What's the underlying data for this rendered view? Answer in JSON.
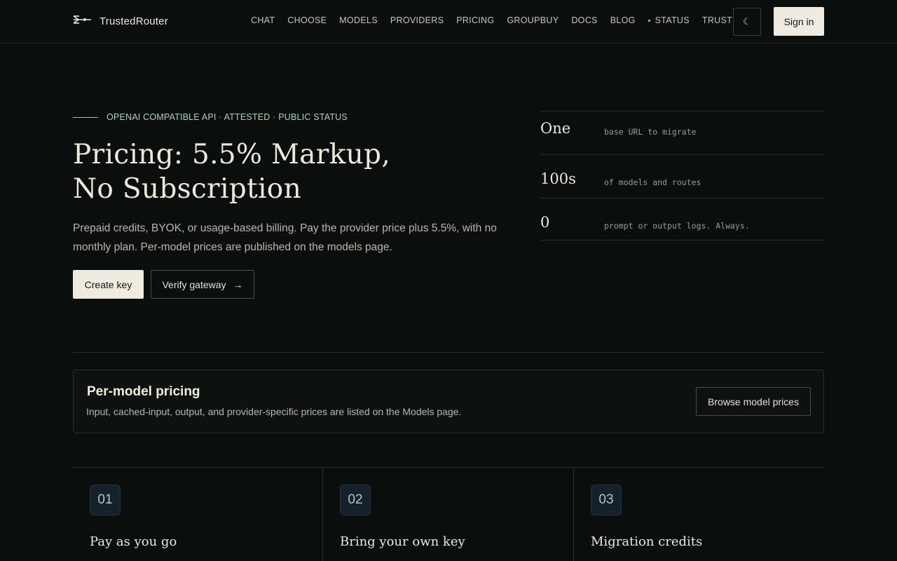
{
  "header": {
    "brand": "TrustedRouter",
    "nav": [
      {
        "label": "CHAT",
        "name": "nav-chat"
      },
      {
        "label": "CHOOSE",
        "name": "nav-choose"
      },
      {
        "label": "MODELS",
        "name": "nav-models"
      },
      {
        "label": "PROVIDERS",
        "name": "nav-providers"
      },
      {
        "label": "PRICING",
        "name": "nav-pricing"
      },
      {
        "label": "GROUPBUY",
        "name": "nav-groupbuy"
      },
      {
        "label": "DOCS",
        "name": "nav-docs"
      },
      {
        "label": "BLOG",
        "name": "nav-blog"
      },
      {
        "label": "STATUS",
        "name": "nav-status",
        "dot": true
      },
      {
        "label": "TRUST",
        "name": "nav-trust"
      }
    ],
    "theme_icon": "moon-icon",
    "theme_glyph": "☾",
    "signin_label": "Sign in"
  },
  "hero": {
    "eyebrow": "OPENAI COMPATIBLE API · ATTESTED · PUBLIC STATUS",
    "title_line1": "Pricing: 5.5% Markup,",
    "title_line2": "No Subscription",
    "description": "Prepaid credits, BYOK, or usage-based billing. Pay the provider price plus 5.5%, with no monthly plan. Per-model prices are published on the models page.",
    "primary_label": "Create key",
    "secondary_label": "Verify gateway",
    "secondary_arrow": "→"
  },
  "stats": [
    {
      "value": "One",
      "label": "base URL to migrate"
    },
    {
      "value": "100s",
      "label": "of models and routes"
    },
    {
      "value": "0",
      "label": "prompt or output logs. Always."
    }
  ],
  "pricing_card": {
    "title": "Per-model pricing",
    "description": "Input, cached-input, output, and provider-specific prices are listed on the Models page.",
    "button_label": "Browse model prices"
  },
  "features": [
    {
      "number": "01",
      "title": "Pay as you go"
    },
    {
      "number": "02",
      "title": "Bring your own key"
    },
    {
      "number": "03",
      "title": "Migration credits"
    }
  ]
}
